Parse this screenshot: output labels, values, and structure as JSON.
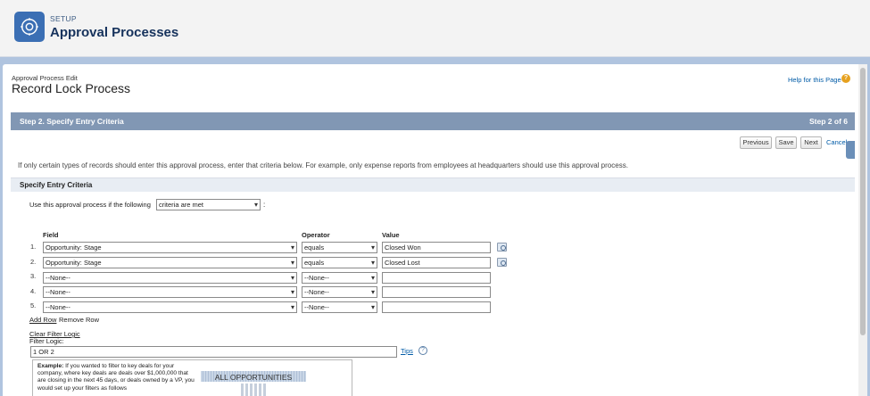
{
  "header": {
    "eyebrow": "SETUP",
    "title": "Approval Processes",
    "icon": "gear-icon"
  },
  "page": {
    "eyebrow": "Approval Process Edit",
    "title": "Record Lock Process",
    "help_link": "Help for this Page",
    "help_icon": "question-icon"
  },
  "step_bar": {
    "title": "Step 2. Specify Entry Criteria",
    "count": "Step 2 of 6"
  },
  "buttons": {
    "previous": "Previous",
    "save": "Save",
    "next": "Next",
    "cancel": "Cancel"
  },
  "info_text": "If only certain types of records should enter this approval process, enter that criteria below. For example, only expense reports from employees at headquarters should use this approval process.",
  "section": {
    "title": "Specify Entry Criteria",
    "use_label": "Use this approval process if the following",
    "criteria_select": "criteria are met",
    "colon": ":"
  },
  "criteria_table": {
    "headers": {
      "field": "Field",
      "operator": "Operator",
      "value": "Value"
    },
    "rows": [
      {
        "num": "1.",
        "field": "Opportunity: Stage",
        "operator": "equals",
        "value": "Closed Won",
        "lookup": true
      },
      {
        "num": "2.",
        "field": "Opportunity: Stage",
        "operator": "equals",
        "value": "Closed Lost",
        "lookup": true
      },
      {
        "num": "3.",
        "field": "--None--",
        "operator": "--None--",
        "value": "",
        "lookup": false
      },
      {
        "num": "4.",
        "field": "--None--",
        "operator": "--None--",
        "value": "",
        "lookup": false
      },
      {
        "num": "5.",
        "field": "--None--",
        "operator": "--None--",
        "value": "",
        "lookup": false
      }
    ]
  },
  "row_actions": {
    "add_row": "Add Row",
    "remove_row": "Remove Row"
  },
  "filter_logic": {
    "clear_link": "Clear Filter Logic",
    "label": "Filter Logic:",
    "value": "1 OR 2",
    "tips": "Tips"
  },
  "example": {
    "lead": "Example:",
    "text": " If you wanted to filter to key deals for your company, where key deals are deals over $1,000,000 that are closing in the next 45 days, or deals owned by a VP, you would set up your filters as follows",
    "graphic_label": "ALL OPPORTUNITIES"
  },
  "colors": {
    "step_bar": "#8197b4",
    "link": "#015ba7",
    "brand": "#3b6fb4"
  }
}
